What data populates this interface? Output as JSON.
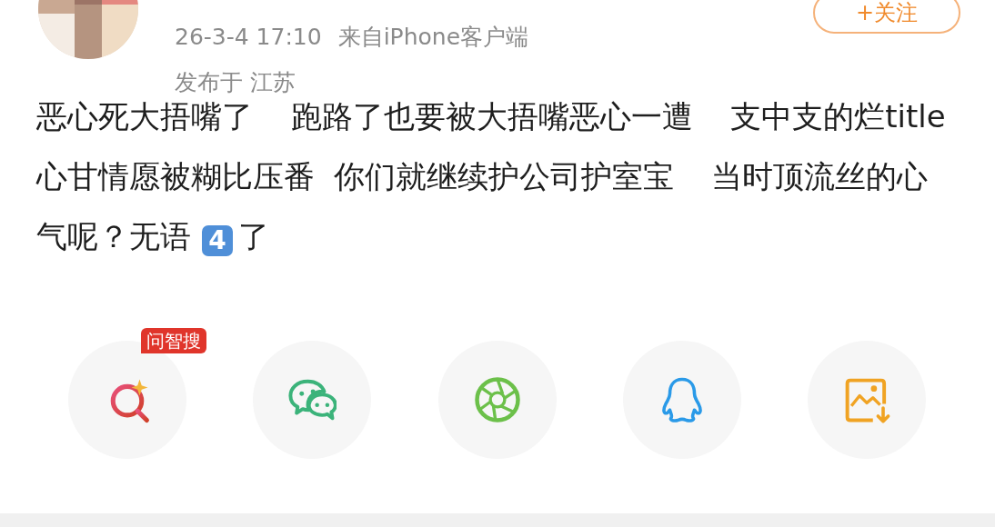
{
  "post": {
    "follow_button": "+关注",
    "timestamp": "26-3-4 17:10",
    "source": "来自iPhone客户端",
    "location": "发布于 江苏",
    "body": [
      {
        "kind": "text",
        "text": "恶心死大捂嘴了  跑路了也要被大捂嘴恶心一遭  支中支的烂title 心甘情愿被糊比压番 你们就继续护公司护室宝  当时顶流丝的心气呢？无语"
      },
      {
        "kind": "keycap",
        "text": "4"
      },
      {
        "kind": "text",
        "text": "了"
      }
    ]
  },
  "share_targets": [
    {
      "kind": "ai-search",
      "badge": "问智搜"
    },
    {
      "kind": "wechat"
    },
    {
      "kind": "moments"
    },
    {
      "kind": "qq"
    },
    {
      "kind": "save-image"
    }
  ]
}
